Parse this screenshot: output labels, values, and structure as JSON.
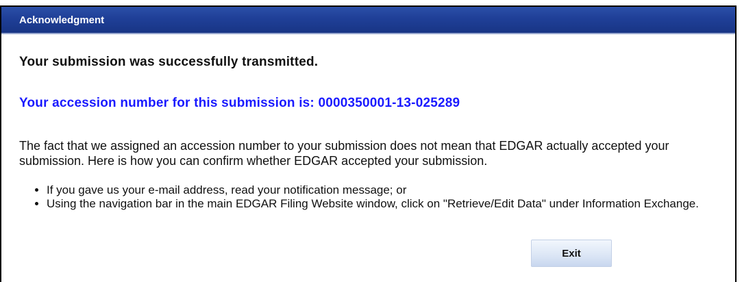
{
  "dialog": {
    "title": "Acknowledgment",
    "success_message": "Your submission was successfully transmitted.",
    "accession_message": "Your accession number for this submission is: 0000350001-13-025289",
    "explanation": "The fact that we assigned an accession number to your submission does not mean that EDGAR actually accepted your submission. Here is how you can confirm whether EDGAR accepted your submission.",
    "bullets": [
      "If you gave us your e-mail address, read your notification message; or",
      "Using the navigation bar in the main EDGAR Filing Website window, click on \"Retrieve/Edit Data\" under Information Exchange."
    ],
    "exit_label": "Exit"
  },
  "colors": {
    "titlebar": "#1f3f97",
    "accession_text": "#1a1aff",
    "button": "#dde7f6"
  }
}
